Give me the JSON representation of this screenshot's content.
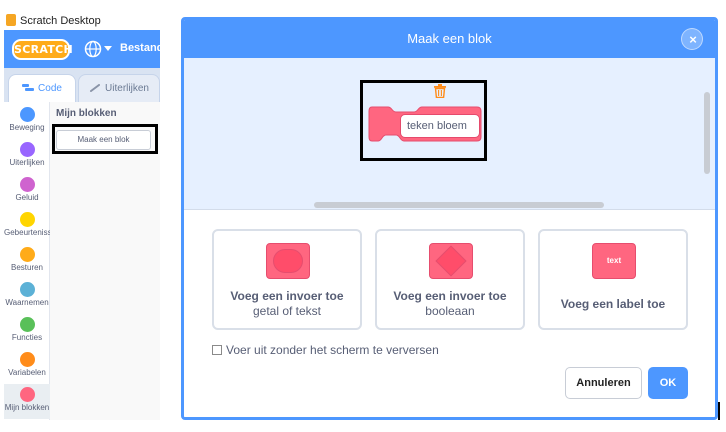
{
  "window": {
    "title": "Scratch Desktop"
  },
  "menubar": {
    "logo_text": "SCRATCH",
    "globe_icon": "globe-icon",
    "file_menu": "Bestand"
  },
  "tabs": {
    "code": "Code",
    "costumes": "Uiterlijken"
  },
  "categories": [
    {
      "label": "Beweging",
      "color": "#4c97ff"
    },
    {
      "label": "Uiterlijken",
      "color": "#9966ff"
    },
    {
      "label": "Geluid",
      "color": "#cf63cf"
    },
    {
      "label": "Gebeurtenissen",
      "color": "#ffd500"
    },
    {
      "label": "Besturen",
      "color": "#ffab19"
    },
    {
      "label": "Waarnemen",
      "color": "#5cb1d6"
    },
    {
      "label": "Functies",
      "color": "#59c059"
    },
    {
      "label": "Variabelen",
      "color": "#ff8c1a"
    },
    {
      "label": "Mijn blokken",
      "color": "#ff6680"
    }
  ],
  "palette": {
    "heading": "Mijn blokken",
    "make_block_button": "Maak een blok"
  },
  "modal": {
    "title": "Maak een blok",
    "close_label": "×",
    "block_name_value": "teken bloem",
    "options": [
      {
        "title": "Voeg een invoer toe",
        "subtitle": "getal of tekst"
      },
      {
        "title": "Voeg een invoer toe",
        "subtitle": "booleaan"
      },
      {
        "title": "Voeg een label toe",
        "subtitle": "",
        "shape_text": "text"
      }
    ],
    "run_without_refresh": "Voer uit zonder het scherm te verversen",
    "run_without_refresh_checked": false,
    "cancel_button": "Annuleren",
    "ok_button": "OK"
  },
  "colors": {
    "accent": "#4d97ff",
    "my_blocks": "#ff6680",
    "highlight_box": "#000000"
  }
}
